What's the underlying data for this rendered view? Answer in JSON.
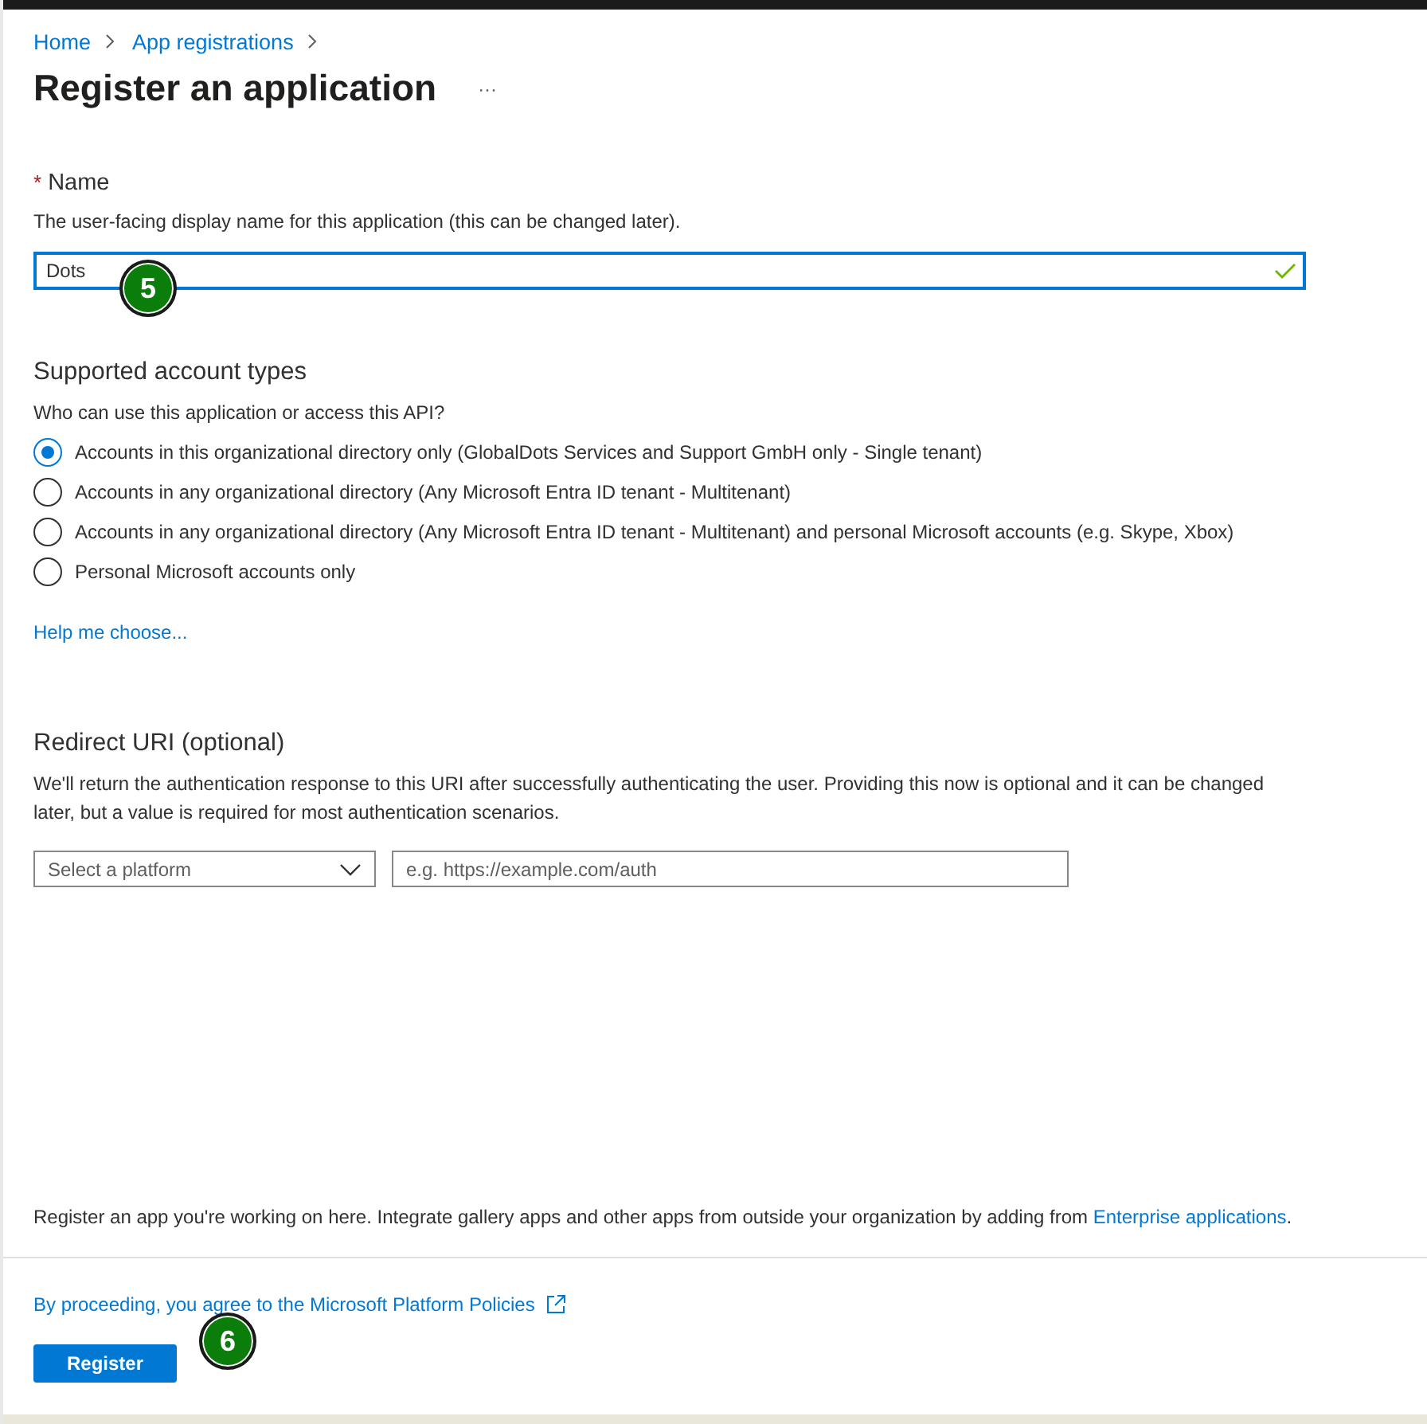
{
  "breadcrumb": [
    {
      "label": "Home"
    },
    {
      "label": "App registrations"
    }
  ],
  "title": "Register an application",
  "more": "···",
  "name_section": {
    "required_mark": "*",
    "label": "Name",
    "description": "The user-facing display name for this application (this can be changed later).",
    "value": "Dots",
    "valid": true
  },
  "account_types": {
    "heading": "Supported account types",
    "question": "Who can use this application or access this API?",
    "options": [
      {
        "label": "Accounts in this organizational directory only (GlobalDots Services and Support GmbH only - Single tenant)",
        "selected": true
      },
      {
        "label": "Accounts in any organizational directory (Any Microsoft Entra ID tenant - Multitenant)",
        "selected": false
      },
      {
        "label": "Accounts in any organizational directory (Any Microsoft Entra ID tenant - Multitenant) and personal Microsoft accounts (e.g. Skype, Xbox)",
        "selected": false
      },
      {
        "label": "Personal Microsoft accounts only",
        "selected": false
      }
    ],
    "help_link": "Help me choose..."
  },
  "redirect": {
    "heading": "Redirect URI (optional)",
    "description": "We'll return the authentication response to this URI after successfully authenticating the user. Providing this now is optional and it can be changed later, but a value is required for most authentication scenarios.",
    "platform_placeholder": "Select a platform",
    "uri_placeholder": "e.g. https://example.com/auth"
  },
  "gallery_note": {
    "text": "Register an app you're working on here. Integrate gallery apps and other apps from outside your organization by adding from",
    "link": "Enterprise applications",
    "end": "."
  },
  "footer": {
    "policy_link": "By proceeding, you agree to the Microsoft Platform Policies",
    "button": "Register"
  },
  "step_badges": [
    {
      "label": "5"
    },
    {
      "label": "6"
    }
  ]
}
